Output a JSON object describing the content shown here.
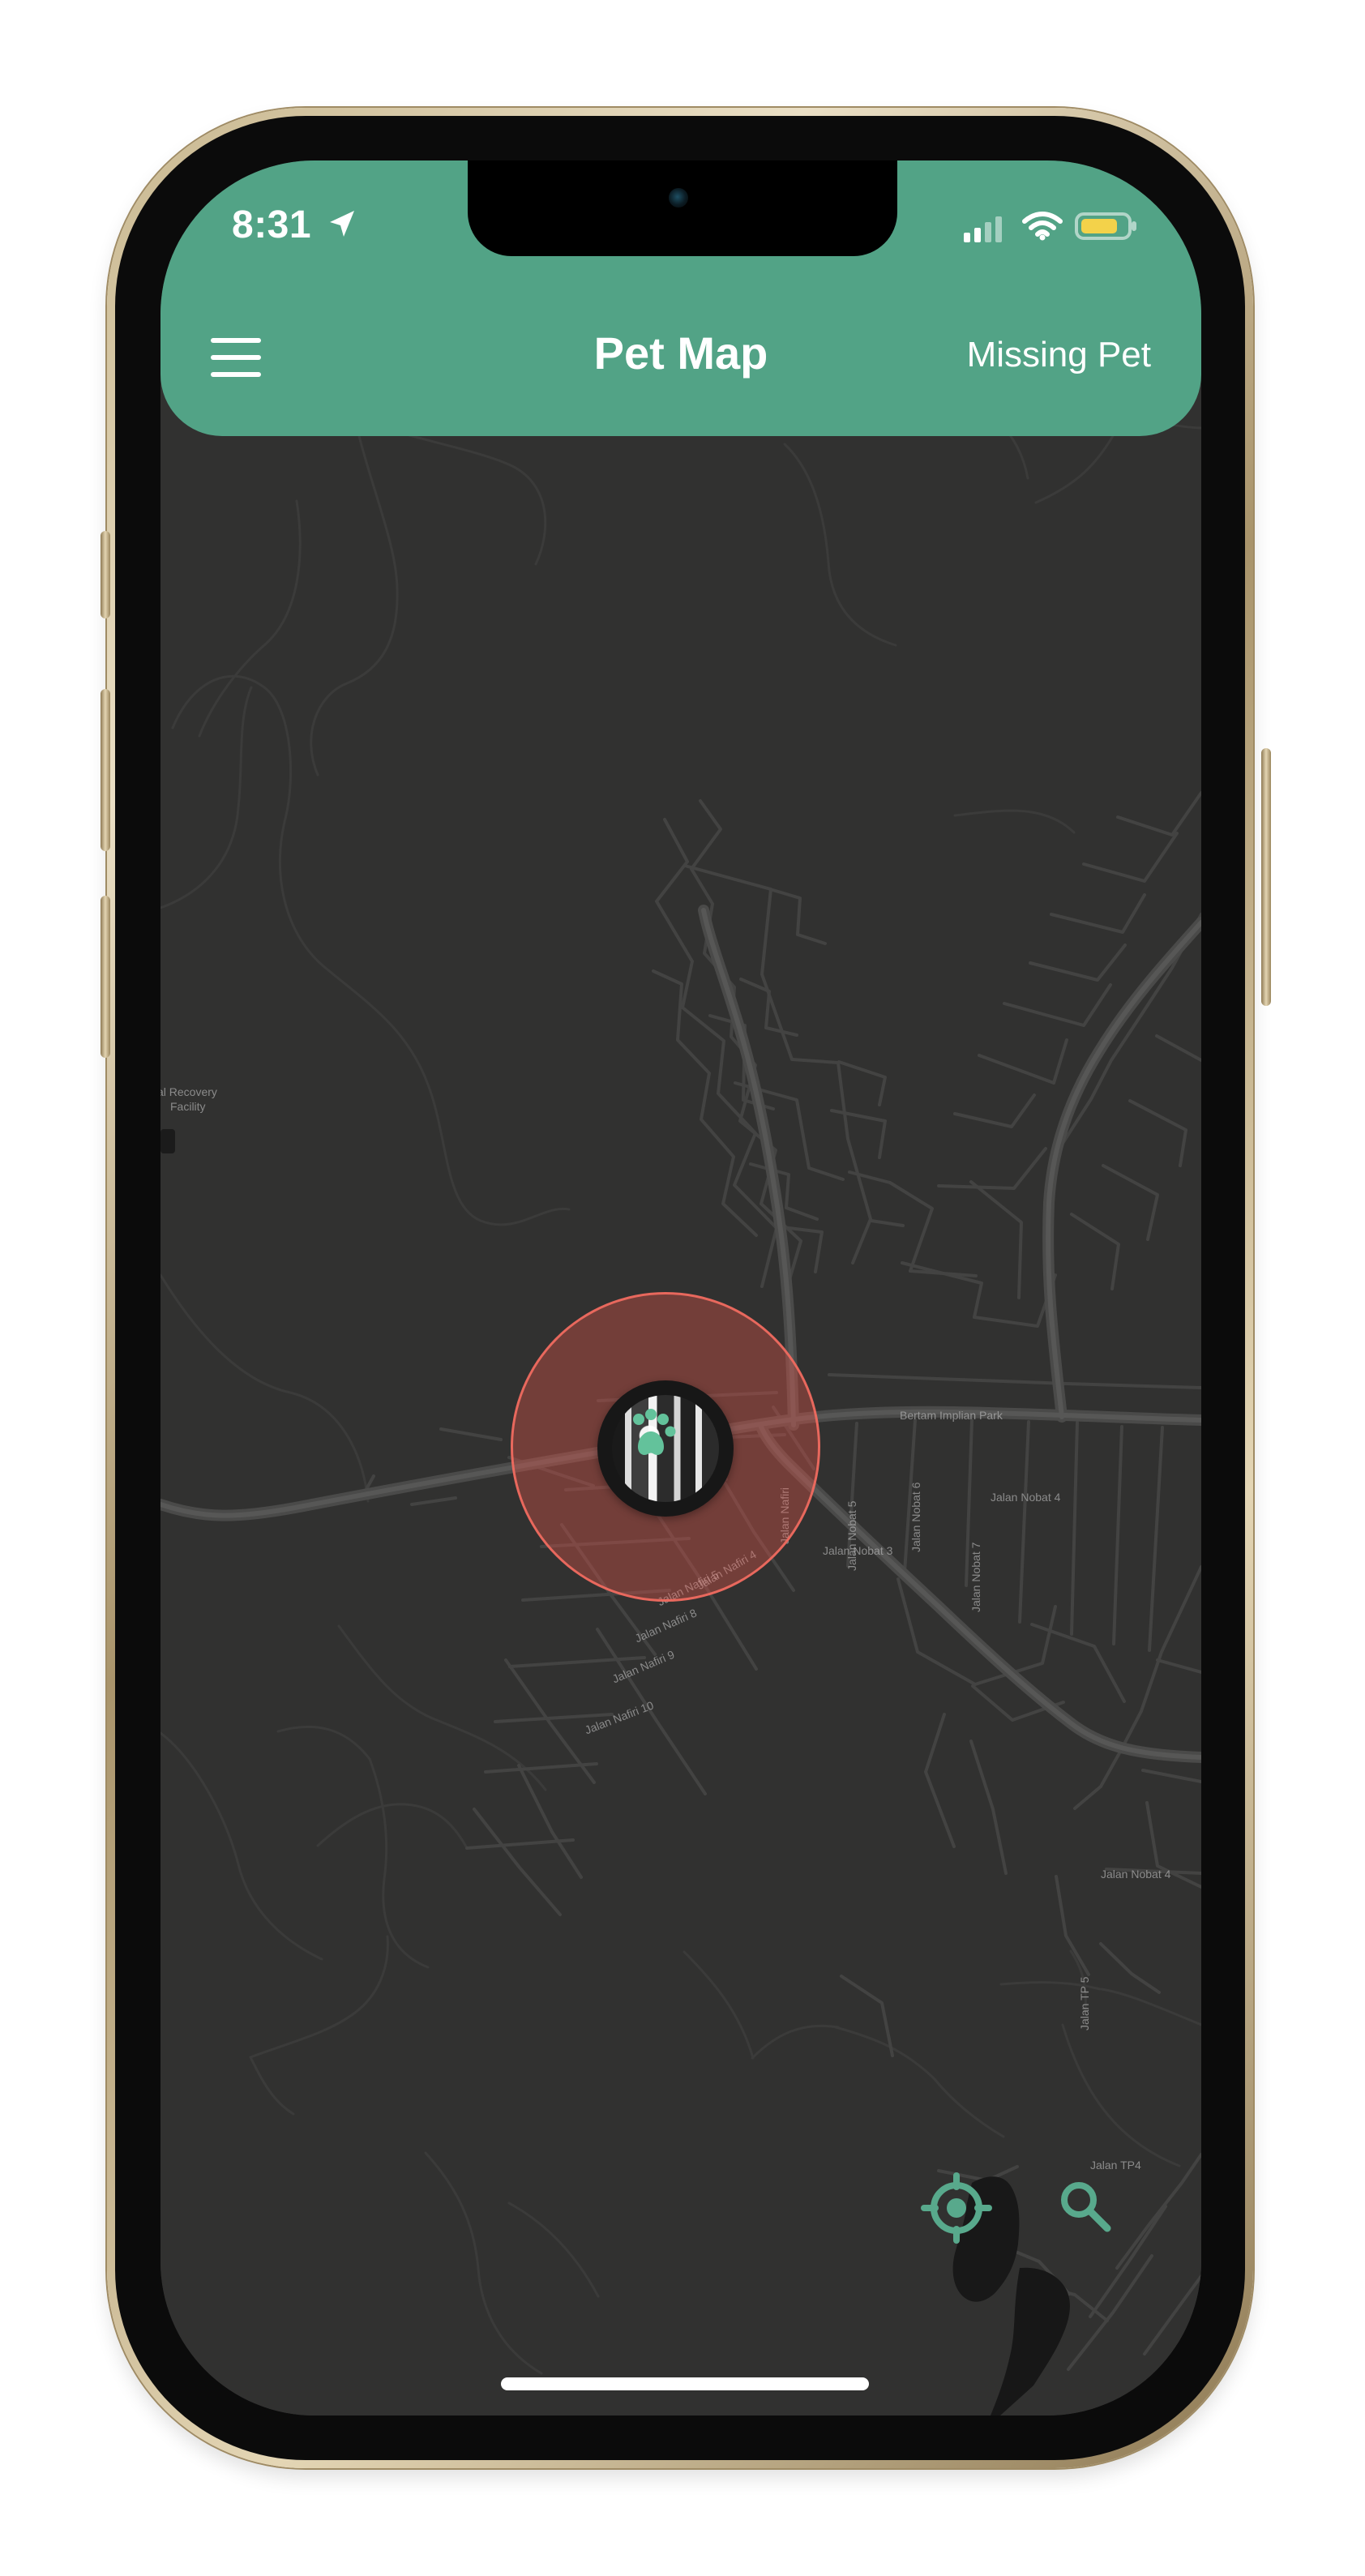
{
  "status_bar": {
    "time": "8:31"
  },
  "header": {
    "title": "Pet Map",
    "missing_pet_label": "Missing Pet"
  },
  "map": {
    "labels": {
      "facility": "al Recovery",
      "facility_2": "Facility",
      "park": "Bertam Implian Park",
      "nobat_4": "Jalan Nobat 4",
      "nobat_3": "Jalan Nobat 3",
      "nobat_5": "Jalan Nobat 5",
      "nobat_6": "Jalan Nobat 6",
      "nobat_7": "Jalan Nobat 7",
      "nafiri_4": "Jalan Nafiri 4",
      "nafiri_5": "Jalan Nafiri 5",
      "nafiri_8": "Jalan Nafiri 8",
      "nafiri_9": "Jalan Nafiri 9",
      "nafiri_10": "Jalan Nafiri 10",
      "nobat_4_right": "Jalan Nobat 4",
      "tp5": "Jalan TP 5",
      "tp4": "Jalan TP4",
      "nafiri": "Jalan Nafiri"
    }
  },
  "colors": {
    "header": "#52a386",
    "map_background": "#313130",
    "accent": "#5db393",
    "range_fill": "#e8554a"
  },
  "icons": {
    "menu": "menu-icon",
    "location_arrow": "location-arrow-icon",
    "signal": "signal-icon",
    "wifi": "wifi-icon",
    "battery": "battery-icon",
    "paw": "paw-icon",
    "recenter": "crosshair-icon",
    "search": "search-icon"
  }
}
